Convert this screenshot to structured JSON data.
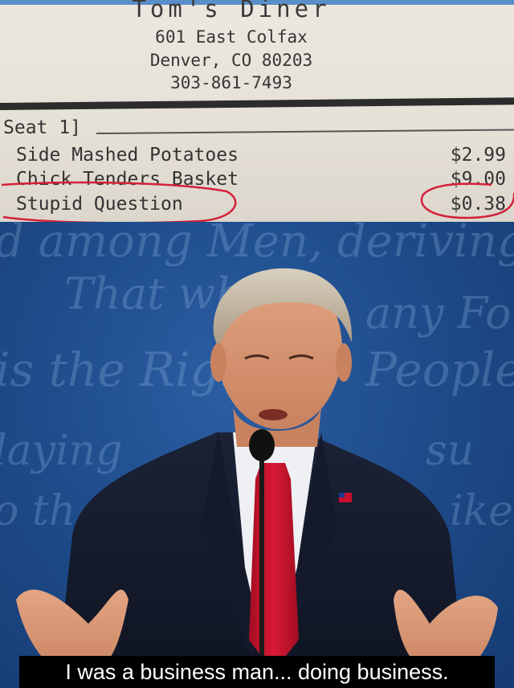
{
  "receipt": {
    "store_name": "Tom's Diner",
    "address_line1": "601 East Colfax",
    "address_line2": "Denver, CO 80203",
    "phone": "303-861-7493",
    "seat_label": "Seat 1]",
    "items": [
      {
        "name": "Side Mashed Potatoes",
        "price": "$2.99"
      },
      {
        "name": "Chick Tenders Basket",
        "price": "$9.00"
      },
      {
        "name": "Stupid Question",
        "price": "$0.38"
      }
    ],
    "highlight_color": "#d4203a"
  },
  "photo": {
    "background_text": {
      "line1": "d among Men, deriving",
      "line2": "That wh",
      "line3": "any Form",
      "line4": "is the Righ",
      "line5": "People to",
      "line6": "laying",
      "line7": "su",
      "line8": "o th",
      "line9": "ikel"
    },
    "caption": "I was a business man... doing business."
  },
  "colors": {
    "stage_blue": "#1f4d8c",
    "receipt_paper": "#e6e1d8",
    "tie_red": "#c8102e"
  }
}
